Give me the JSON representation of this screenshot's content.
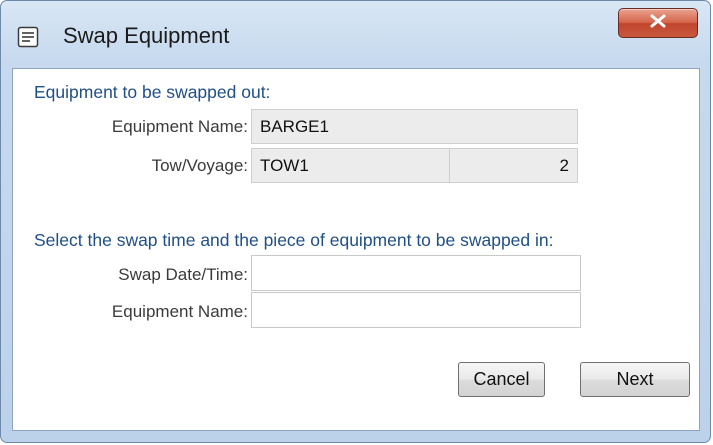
{
  "window": {
    "title": "Swap Equipment",
    "icons": {
      "app": "form-icon",
      "close": "close-icon"
    },
    "colors": {
      "heading": "#1f4f86",
      "close_button": "#c8583f"
    }
  },
  "swap_out": {
    "heading": "Equipment to be swapped out:",
    "equipment_name_label": "Equipment Name:",
    "equipment_name_value": "BARGE1",
    "tow_voyage_label": "Tow/Voyage:",
    "tow_value": "TOW1",
    "voyage_value": "2"
  },
  "swap_in": {
    "heading": "Select the swap time and the piece of equipment to be swapped in:",
    "swap_date_label": "Swap Date/Time:",
    "swap_date_value": "",
    "equipment_name_label": "Equipment Name:",
    "equipment_name_value": ""
  },
  "buttons": {
    "cancel": "Cancel",
    "next": "Next"
  }
}
